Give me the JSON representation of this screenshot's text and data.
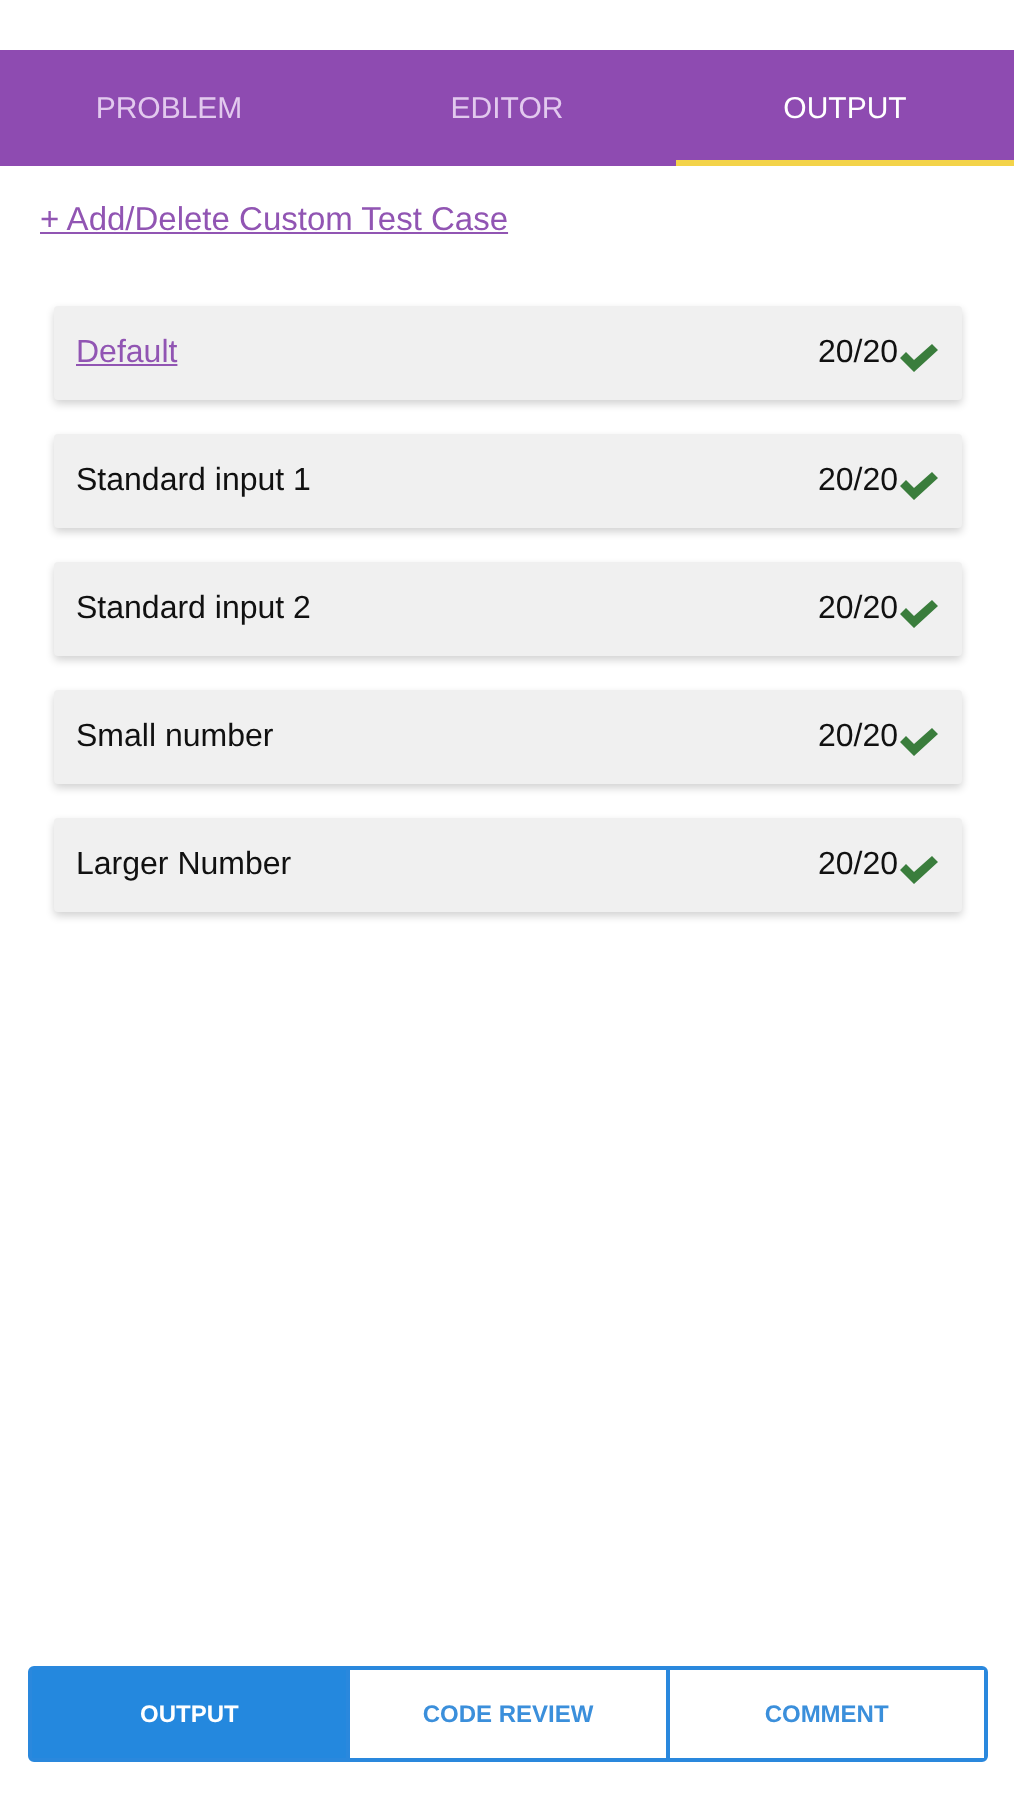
{
  "tabs": [
    {
      "label": "PROBLEM",
      "selected": false
    },
    {
      "label": "EDITOR",
      "selected": false
    },
    {
      "label": "OUTPUT",
      "selected": true
    }
  ],
  "custom_test_link": "+ Add/Delete Custom Test Case",
  "test_cases": [
    {
      "name": "Default",
      "kind": "link",
      "score": "20/20",
      "passed": true
    },
    {
      "name": "Standard input 1",
      "kind": "text",
      "score": "20/20",
      "passed": true
    },
    {
      "name": "Standard input 2",
      "kind": "text",
      "score": "20/20",
      "passed": true
    },
    {
      "name": "Small number",
      "kind": "text",
      "score": "20/20",
      "passed": true
    },
    {
      "name": "Larger Number",
      "kind": "text",
      "score": "20/20",
      "passed": true
    }
  ],
  "bottom_tabs": [
    {
      "label": "OUTPUT",
      "selected": true
    },
    {
      "label": "CODE REVIEW",
      "selected": false
    },
    {
      "label": "COMMENT",
      "selected": false
    }
  ]
}
